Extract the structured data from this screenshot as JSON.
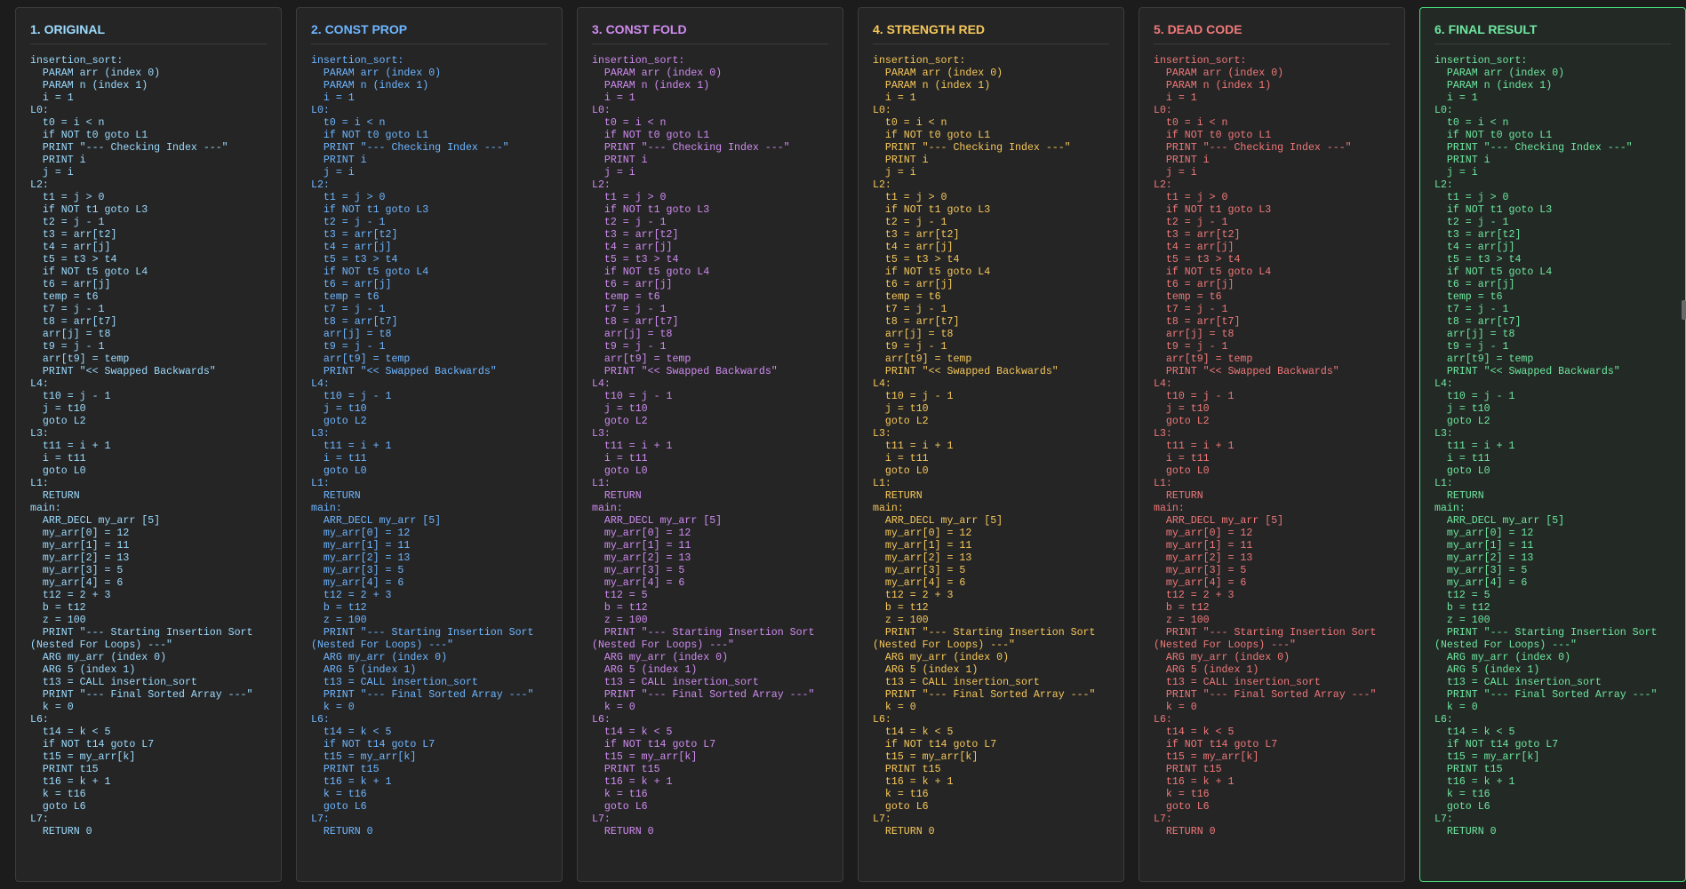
{
  "colors": {
    "original": "#9cdcfe",
    "const_prop": "#6eb6ff",
    "const_fold": "#d08cf0",
    "strength_red": "#f7c85a",
    "dead_code": "#f07878",
    "final": "#6ee7a0"
  },
  "panels": [
    {
      "title": "1. ORIGINAL",
      "code": "insertion_sort:\n  PARAM arr (index 0)\n  PARAM n (index 1)\n  i = 1\nL0:\n  t0 = i < n\n  if NOT t0 goto L1\n  PRINT \"--- Checking Index ---\"\n  PRINT i\n  j = i\nL2:\n  t1 = j > 0\n  if NOT t1 goto L3\n  t2 = j - 1\n  t3 = arr[t2]\n  t4 = arr[j]\n  t5 = t3 > t4\n  if NOT t5 goto L4\n  t6 = arr[j]\n  temp = t6\n  t7 = j - 1\n  t8 = arr[t7]\n  arr[j] = t8\n  t9 = j - 1\n  arr[t9] = temp\n  PRINT \"<< Swapped Backwards\"\nL4:\n  t10 = j - 1\n  j = t10\n  goto L2\nL3:\n  t11 = i + 1\n  i = t11\n  goto L0\nL1:\n  RETURN\nmain:\n  ARR_DECL my_arr [5]\n  my_arr[0] = 12\n  my_arr[1] = 11\n  my_arr[2] = 13\n  my_arr[3] = 5\n  my_arr[4] = 6\n  t12 = 2 + 3\n  b = t12\n  z = 100\n  PRINT \"--- Starting Insertion Sort (Nested For Loops) ---\"\n  ARG my_arr (index 0)\n  ARG 5 (index 1)\n  t13 = CALL insertion_sort\n  PRINT \"--- Final Sorted Array ---\"\n  k = 0\nL6:\n  t14 = k < 5\n  if NOT t14 goto L7\n  t15 = my_arr[k]\n  PRINT t15\n  t16 = k + 1\n  k = t16\n  goto L6\nL7:\n  RETURN 0"
    },
    {
      "title": "2. CONST PROP",
      "code": "insertion_sort:\n  PARAM arr (index 0)\n  PARAM n (index 1)\n  i = 1\nL0:\n  t0 = i < n\n  if NOT t0 goto L1\n  PRINT \"--- Checking Index ---\"\n  PRINT i\n  j = i\nL2:\n  t1 = j > 0\n  if NOT t1 goto L3\n  t2 = j - 1\n  t3 = arr[t2]\n  t4 = arr[j]\n  t5 = t3 > t4\n  if NOT t5 goto L4\n  t6 = arr[j]\n  temp = t6\n  t7 = j - 1\n  t8 = arr[t7]\n  arr[j] = t8\n  t9 = j - 1\n  arr[t9] = temp\n  PRINT \"<< Swapped Backwards\"\nL4:\n  t10 = j - 1\n  j = t10\n  goto L2\nL3:\n  t11 = i + 1\n  i = t11\n  goto L0\nL1:\n  RETURN\nmain:\n  ARR_DECL my_arr [5]\n  my_arr[0] = 12\n  my_arr[1] = 11\n  my_arr[2] = 13\n  my_arr[3] = 5\n  my_arr[4] = 6\n  t12 = 2 + 3\n  b = t12\n  z = 100\n  PRINT \"--- Starting Insertion Sort (Nested For Loops) ---\"\n  ARG my_arr (index 0)\n  ARG 5 (index 1)\n  t13 = CALL insertion_sort\n  PRINT \"--- Final Sorted Array ---\"\n  k = 0\nL6:\n  t14 = k < 5\n  if NOT t14 goto L7\n  t15 = my_arr[k]\n  PRINT t15\n  t16 = k + 1\n  k = t16\n  goto L6\nL7:\n  RETURN 0"
    },
    {
      "title": "3. CONST FOLD",
      "code": "insertion_sort:\n  PARAM arr (index 0)\n  PARAM n (index 1)\n  i = 1\nL0:\n  t0 = i < n\n  if NOT t0 goto L1\n  PRINT \"--- Checking Index ---\"\n  PRINT i\n  j = i\nL2:\n  t1 = j > 0\n  if NOT t1 goto L3\n  t2 = j - 1\n  t3 = arr[t2]\n  t4 = arr[j]\n  t5 = t3 > t4\n  if NOT t5 goto L4\n  t6 = arr[j]\n  temp = t6\n  t7 = j - 1\n  t8 = arr[t7]\n  arr[j] = t8\n  t9 = j - 1\n  arr[t9] = temp\n  PRINT \"<< Swapped Backwards\"\nL4:\n  t10 = j - 1\n  j = t10\n  goto L2\nL3:\n  t11 = i + 1\n  i = t11\n  goto L0\nL1:\n  RETURN\nmain:\n  ARR_DECL my_arr [5]\n  my_arr[0] = 12\n  my_arr[1] = 11\n  my_arr[2] = 13\n  my_arr[3] = 5\n  my_arr[4] = 6\n  t12 = 5\n  b = t12\n  z = 100\n  PRINT \"--- Starting Insertion Sort (Nested For Loops) ---\"\n  ARG my_arr (index 0)\n  ARG 5 (index 1)\n  t13 = CALL insertion_sort\n  PRINT \"--- Final Sorted Array ---\"\n  k = 0\nL6:\n  t14 = k < 5\n  if NOT t14 goto L7\n  t15 = my_arr[k]\n  PRINT t15\n  t16 = k + 1\n  k = t16\n  goto L6\nL7:\n  RETURN 0"
    },
    {
      "title": "4. STRENGTH RED",
      "code": "insertion_sort:\n  PARAM arr (index 0)\n  PARAM n (index 1)\n  i = 1\nL0:\n  t0 = i < n\n  if NOT t0 goto L1\n  PRINT \"--- Checking Index ---\"\n  PRINT i\n  j = i\nL2:\n  t1 = j > 0\n  if NOT t1 goto L3\n  t2 = j - 1\n  t3 = arr[t2]\n  t4 = arr[j]\n  t5 = t3 > t4\n  if NOT t5 goto L4\n  t6 = arr[j]\n  temp = t6\n  t7 = j - 1\n  t8 = arr[t7]\n  arr[j] = t8\n  t9 = j - 1\n  arr[t9] = temp\n  PRINT \"<< Swapped Backwards\"\nL4:\n  t10 = j - 1\n  j = t10\n  goto L2\nL3:\n  t11 = i + 1\n  i = t11\n  goto L0\nL1:\n  RETURN\nmain:\n  ARR_DECL my_arr [5]\n  my_arr[0] = 12\n  my_arr[1] = 11\n  my_arr[2] = 13\n  my_arr[3] = 5\n  my_arr[4] = 6\n  t12 = 2 + 3\n  b = t12\n  z = 100\n  PRINT \"--- Starting Insertion Sort (Nested For Loops) ---\"\n  ARG my_arr (index 0)\n  ARG 5 (index 1)\n  t13 = CALL insertion_sort\n  PRINT \"--- Final Sorted Array ---\"\n  k = 0\nL6:\n  t14 = k < 5\n  if NOT t14 goto L7\n  t15 = my_arr[k]\n  PRINT t15\n  t16 = k + 1\n  k = t16\n  goto L6\nL7:\n  RETURN 0"
    },
    {
      "title": "5. DEAD CODE",
      "code": "insertion_sort:\n  PARAM arr (index 0)\n  PARAM n (index 1)\n  i = 1\nL0:\n  t0 = i < n\n  if NOT t0 goto L1\n  PRINT \"--- Checking Index ---\"\n  PRINT i\n  j = i\nL2:\n  t1 = j > 0\n  if NOT t1 goto L3\n  t2 = j - 1\n  t3 = arr[t2]\n  t4 = arr[j]\n  t5 = t3 > t4\n  if NOT t5 goto L4\n  t6 = arr[j]\n  temp = t6\n  t7 = j - 1\n  t8 = arr[t7]\n  arr[j] = t8\n  t9 = j - 1\n  arr[t9] = temp\n  PRINT \"<< Swapped Backwards\"\nL4:\n  t10 = j - 1\n  j = t10\n  goto L2\nL3:\n  t11 = i + 1\n  i = t11\n  goto L0\nL1:\n  RETURN\nmain:\n  ARR_DECL my_arr [5]\n  my_arr[0] = 12\n  my_arr[1] = 11\n  my_arr[2] = 13\n  my_arr[3] = 5\n  my_arr[4] = 6\n  t12 = 2 + 3\n  b = t12\n  z = 100\n  PRINT \"--- Starting Insertion Sort (Nested For Loops) ---\"\n  ARG my_arr (index 0)\n  ARG 5 (index 1)\n  t13 = CALL insertion_sort\n  PRINT \"--- Final Sorted Array ---\"\n  k = 0\nL6:\n  t14 = k < 5\n  if NOT t14 goto L7\n  t15 = my_arr[k]\n  PRINT t15\n  t16 = k + 1\n  k = t16\n  goto L6\nL7:\n  RETURN 0"
    },
    {
      "title": "6. FINAL RESULT",
      "code": "insertion_sort:\n  PARAM arr (index 0)\n  PARAM n (index 1)\n  i = 1\nL0:\n  t0 = i < n\n  if NOT t0 goto L1\n  PRINT \"--- Checking Index ---\"\n  PRINT i\n  j = i\nL2:\n  t1 = j > 0\n  if NOT t1 goto L3\n  t2 = j - 1\n  t3 = arr[t2]\n  t4 = arr[j]\n  t5 = t3 > t4\n  if NOT t5 goto L4\n  t6 = arr[j]\n  temp = t6\n  t7 = j - 1\n  t8 = arr[t7]\n  arr[j] = t8\n  t9 = j - 1\n  arr[t9] = temp\n  PRINT \"<< Swapped Backwards\"\nL4:\n  t10 = j - 1\n  j = t10\n  goto L2\nL3:\n  t11 = i + 1\n  i = t11\n  goto L0\nL1:\n  RETURN\nmain:\n  ARR_DECL my_arr [5]\n  my_arr[0] = 12\n  my_arr[1] = 11\n  my_arr[2] = 13\n  my_arr[3] = 5\n  my_arr[4] = 6\n  t12 = 5\n  b = t12\n  z = 100\n  PRINT \"--- Starting Insertion Sort (Nested For Loops) ---\"\n  ARG my_arr (index 0)\n  ARG 5 (index 1)\n  t13 = CALL insertion_sort\n  PRINT \"--- Final Sorted Array ---\"\n  k = 0\nL6:\n  t14 = k < 5\n  if NOT t14 goto L7\n  t15 = my_arr[k]\n  PRINT t15\n  t16 = k + 1\n  k = t16\n  goto L6\nL7:\n  RETURN 0"
    }
  ]
}
